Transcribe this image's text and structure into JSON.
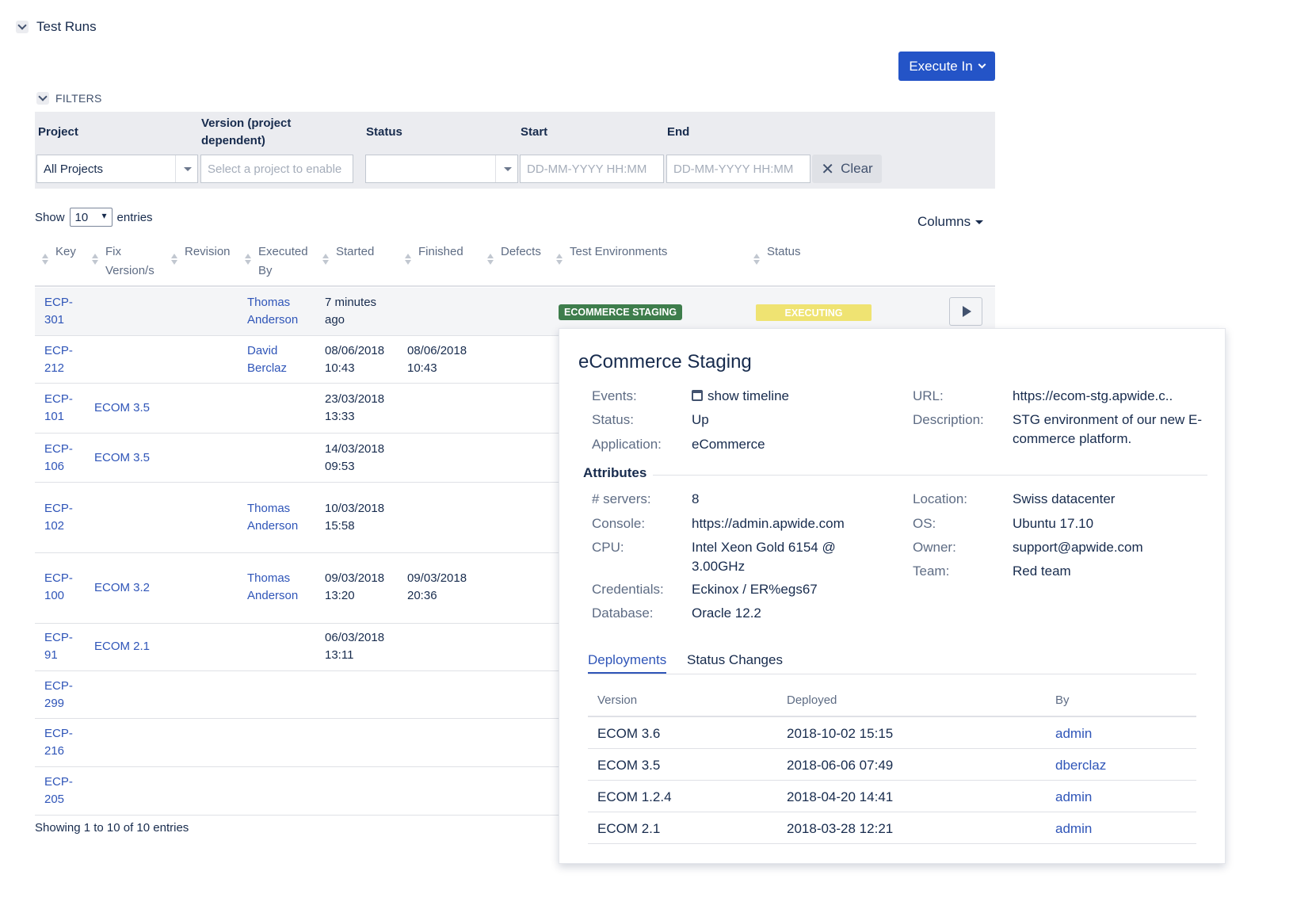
{
  "section": {
    "title": "Test Runs"
  },
  "execute_button": "Execute In",
  "filters": {
    "toggle_label": "FILTERS",
    "project_label": "Project",
    "version_label_1": "Version (project",
    "version_label_2": "dependent)",
    "status_label": "Status",
    "start_label": "Start",
    "end_label": "End",
    "project_value": "All Projects",
    "version_placeholder": "Select a project to enable",
    "status_value": "",
    "start_placeholder": "DD-MM-YYYY HH:MM",
    "end_placeholder": "DD-MM-YYYY HH:MM",
    "clear_label": "Clear"
  },
  "entries": {
    "show": "Show",
    "value": "10",
    "suffix": "entries"
  },
  "columns_button": "Columns",
  "table": {
    "headers": {
      "key": "Key",
      "fix1": "Fix",
      "fix2": "Version/s",
      "revision": "Revision",
      "exec1": "Executed",
      "exec2": "By",
      "started": "Started",
      "finished": "Finished",
      "defects": "Defects",
      "envs": "Test Environments",
      "status": "Status"
    },
    "rows": [
      {
        "key1": "ECP-",
        "key2": "301",
        "fix": "",
        "by1": "Thomas",
        "by2": "Anderson",
        "start1": "7 minutes",
        "start2": "ago",
        "end1": "",
        "end2": "",
        "env": "ECOMMERCE STAGING",
        "status": "EXECUTING"
      },
      {
        "key1": "ECP-",
        "key2": "212",
        "fix": "",
        "by1": "David",
        "by2": "Berclaz",
        "start1": "08/06/2018",
        "start2": "10:43",
        "end1": "08/06/2018",
        "end2": "10:43"
      },
      {
        "key1": "ECP-",
        "key2": "101",
        "fix": "ECOM 3.5",
        "by1": "",
        "by2": "",
        "start1": "23/03/2018",
        "start2": "13:33",
        "end1": "",
        "end2": ""
      },
      {
        "key1": "ECP-",
        "key2": "106",
        "fix": "ECOM 3.5",
        "by1": "",
        "by2": "",
        "start1": "14/03/2018",
        "start2": "09:53",
        "end1": "",
        "end2": ""
      },
      {
        "key1": "ECP-",
        "key2": "102",
        "fix": "",
        "by1": "Thomas",
        "by2": "Anderson",
        "start1": "10/03/2018",
        "start2": "15:58",
        "end1": "",
        "end2": ""
      },
      {
        "key1": "ECP-",
        "key2": "100",
        "fix": "ECOM 3.2",
        "by1": "Thomas",
        "by2": "Anderson",
        "start1": "09/03/2018",
        "start2": "13:20",
        "end1": "09/03/2018",
        "end2": "20:36"
      },
      {
        "key1": "ECP-",
        "key2": "91",
        "fix": "ECOM 2.1",
        "by1": "",
        "by2": "",
        "start1": "06/03/2018",
        "start2": "13:11",
        "end1": "",
        "end2": ""
      },
      {
        "key1": "ECP-",
        "key2": "299",
        "fix": "",
        "by1": "",
        "by2": "",
        "start1": "",
        "start2": "",
        "end1": "",
        "end2": ""
      },
      {
        "key1": "ECP-",
        "key2": "216",
        "fix": "",
        "by1": "",
        "by2": "",
        "start1": "",
        "start2": "",
        "end1": "",
        "end2": ""
      },
      {
        "key1": "ECP-",
        "key2": "205",
        "fix": "",
        "by1": "",
        "by2": "",
        "start1": "",
        "start2": "",
        "end1": "",
        "end2": ""
      }
    ],
    "footer": "Showing 1 to 10 of 10 entries"
  },
  "popup": {
    "title": "eCommerce Staging",
    "events_label": "Events:",
    "events_value": "show timeline",
    "status_label": "Status:",
    "status_value": "Up",
    "application_label": "Application:",
    "application_value": "eCommerce",
    "url_label": "URL:",
    "url_value": "https://ecom-stg.apwide.c..",
    "description_label": "Description:",
    "description_value_1": "STG environment of our new E-",
    "description_value_2": "commerce platform.",
    "attributes_title": "Attributes",
    "servers_label": "# servers:",
    "servers_value": "8",
    "console_label": "Console:",
    "console_value": "https://admin.apwide.com",
    "cpu_label": "CPU:",
    "cpu_value_1": "Intel Xeon Gold 6154 @",
    "cpu_value_2": "3.00GHz",
    "credentials_label": "Credentials:",
    "credentials_value": "Eckinox / ER%egs67",
    "database_label": "Database:",
    "database_value": "Oracle 12.2",
    "location_label": "Location:",
    "location_value": "Swiss datacenter",
    "os_label": "OS:",
    "os_value": "Ubuntu 17.10",
    "owner_label": "Owner:",
    "owner_value": "support@apwide.com",
    "team_label": "Team:",
    "team_value": "Red team",
    "tabs": [
      "Deployments",
      "Status Changes"
    ],
    "deployments": {
      "headers": [
        "Version",
        "Deployed",
        "By"
      ],
      "rows": [
        {
          "version": "ECOM 3.6",
          "deployed": "2018-10-02 15:15",
          "by": "admin"
        },
        {
          "version": "ECOM 3.5",
          "deployed": "2018-06-06 07:49",
          "by": "dberclaz"
        },
        {
          "version": "ECOM 1.2.4",
          "deployed": "2018-04-20 14:41",
          "by": "admin"
        },
        {
          "version": "ECOM 2.1",
          "deployed": "2018-03-28 12:21",
          "by": "admin"
        }
      ]
    }
  }
}
